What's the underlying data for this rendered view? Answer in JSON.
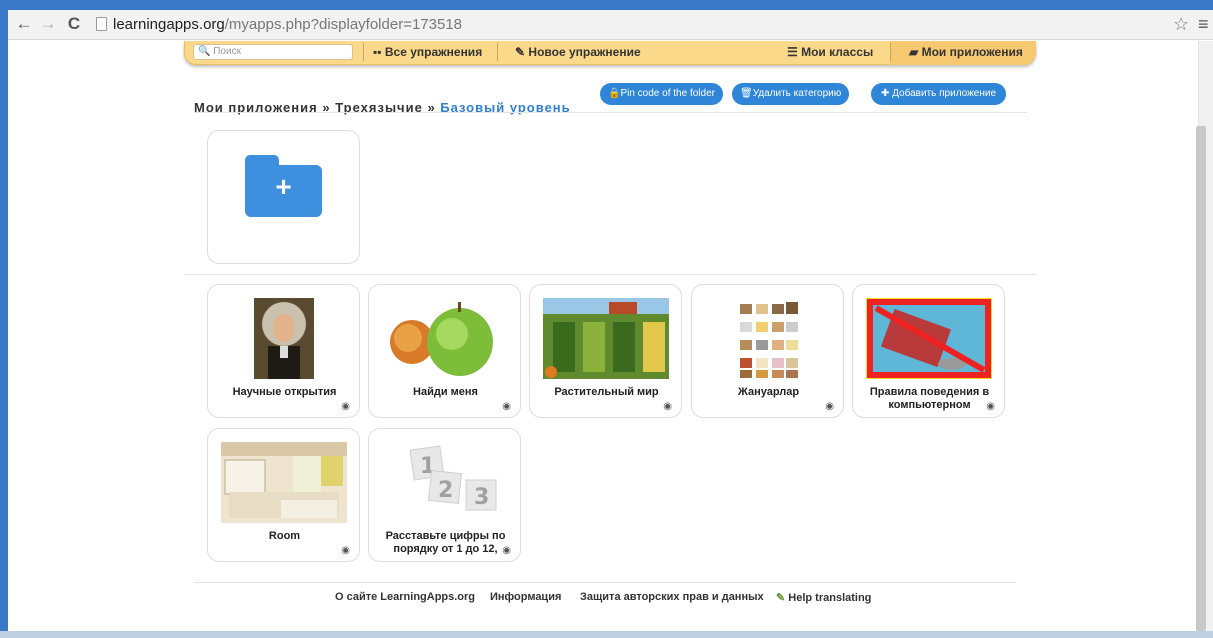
{
  "browser": {
    "url_host": "learningapps.org",
    "url_path": "/myapps.php?displayfolder=173518"
  },
  "nav": {
    "search_placeholder": "Поиск",
    "all_exercises": "Все упражнения",
    "new_exercise": "Новое упражнение",
    "my_classes": "Мои классы",
    "my_apps": "Мои приложения"
  },
  "breadcrumb": {
    "root": "Мои приложения",
    "sep": "»",
    "parent": "Трехязычие",
    "current": "Базовый уровень"
  },
  "actions": {
    "pin_code": "Pin code of the folder",
    "delete_category": "Удалить категорию",
    "add_app": "Добавить приложение"
  },
  "apps": [
    {
      "title": "Научные открытия"
    },
    {
      "title": "Найди меня"
    },
    {
      "title": "Растительный мир"
    },
    {
      "title": "Жануарлар"
    },
    {
      "title": "Правила поведения в компьютерном"
    },
    {
      "title": "Room"
    },
    {
      "title": "Расставьте цифры по порядку от 1 до 12,"
    }
  ],
  "footer": {
    "about": "О сайте LearningApps.org",
    "info": "Информация",
    "copyright": "Защита авторских прав и данных",
    "help": "Help translating"
  },
  "colors": {
    "accent": "#2f86d9",
    "navbar": "#fbd98b",
    "frame": "#3b78c7"
  }
}
